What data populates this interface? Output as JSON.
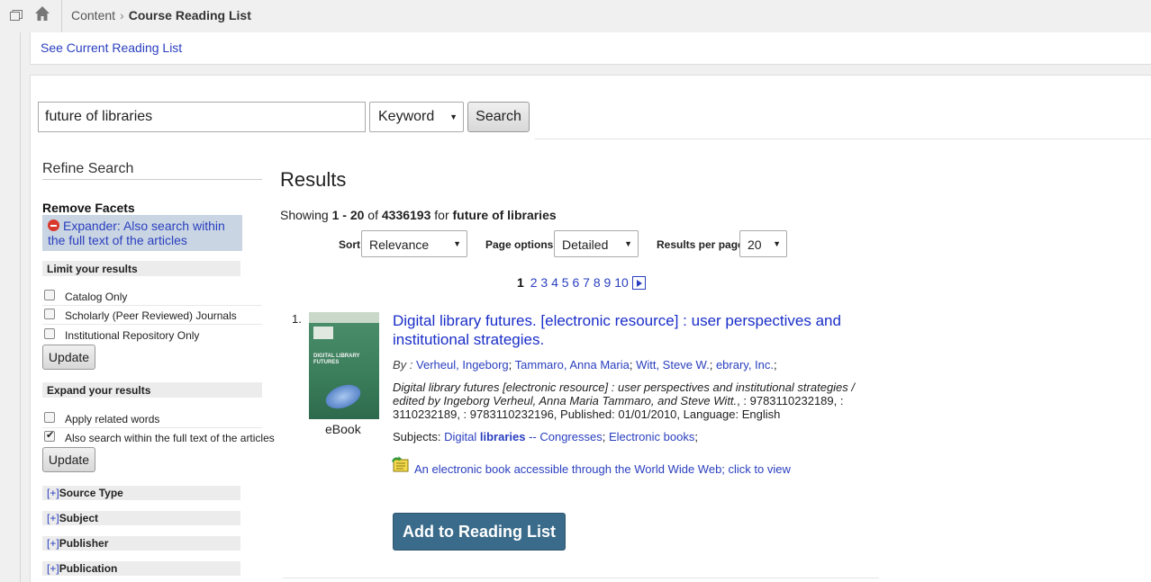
{
  "breadcrumb": {
    "root": "Content",
    "current": "Course Reading List"
  },
  "see_current_link": "See Current Reading List",
  "search": {
    "query": "future of libraries",
    "type": "Keyword",
    "button": "Search"
  },
  "sidebar": {
    "title": "Refine Search",
    "remove_facets": "Remove Facets",
    "expander": "Expander: Also search within the full text of the articles",
    "limit_title": "Limit your results",
    "limit_options": [
      {
        "label": "Catalog Only",
        "checked": false
      },
      {
        "label": "Scholarly (Peer Reviewed) Journals",
        "checked": false
      },
      {
        "label": "Institutional Repository Only",
        "checked": false
      }
    ],
    "update_label": "Update",
    "expand_title": "Expand your results",
    "expand_options": [
      {
        "label": "Apply related words",
        "checked": false
      },
      {
        "label": "Also search within the full text of the articles",
        "checked": true
      }
    ],
    "facets": [
      {
        "plus": "[+]",
        "label": "Source Type"
      },
      {
        "plus": "[+]",
        "label": "Subject"
      },
      {
        "plus": "[+]",
        "label": "Publisher"
      },
      {
        "plus": "[+]",
        "label": "Publication"
      }
    ]
  },
  "results": {
    "title": "Results",
    "showing_prefix": "Showing",
    "range": "1 - 20",
    "of": "of",
    "total": "4336193",
    "for": "for",
    "query": "future of libraries",
    "sort_label": "Sort",
    "sort_value": "Relevance",
    "page_options_label": "Page options",
    "page_options_value": "Detailed",
    "per_page_label": "Results per page",
    "per_page_value": "20",
    "pages": [
      "1",
      "2",
      "3",
      "4",
      "5",
      "6",
      "7",
      "8",
      "9",
      "10"
    ],
    "current_page": "1"
  },
  "record": {
    "number": "1.",
    "format": "eBook",
    "cover_text": "DIGITAL LIBRARY FUTURES",
    "title": "Digital library futures. [electronic resource] : user perspectives and institutional strategies.",
    "by_label": "By :",
    "authors": [
      "Verheul, Ingeborg",
      "Tammaro, Anna Maria",
      "Witt, Steve W.",
      "ebrary, Inc."
    ],
    "desc_italic": "Digital library futures [electronic resource] : user perspectives and institutional strategies / edited by Ingeborg Verheul, Anna Maria Tammaro, and Steve Witt.",
    "desc_rest": ", : 9783110232189, : 3110232189, : 9783110232196, Published: 01/01/2010, Language: English",
    "subjects_label": "Subjects:",
    "subject_1_prefix": "Digital",
    "subject_1_bold": "libraries",
    "subject_1_suffix": "-- Congresses",
    "subject_2": "Electronic books",
    "access_link": "An electronic book accessible through the World Wide Web; click to view",
    "add_button": "Add to Reading List"
  }
}
